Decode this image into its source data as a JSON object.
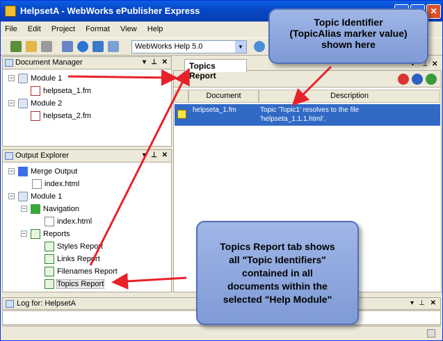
{
  "window": {
    "title": "HelpsetA - WebWorks ePublisher Express",
    "minimize_label": "_",
    "maximize_label": "□",
    "close_label": "✕"
  },
  "menu": [
    "File",
    "Edit",
    "Project",
    "Format",
    "View",
    "Help"
  ],
  "toolbar": {
    "format_select_value": "WebWorks Help 5.0",
    "icons": [
      "new-project-icon",
      "open-icon",
      "save-icon",
      "search-icon",
      "settings-icon",
      "target-icon",
      "wizard-icon"
    ]
  },
  "document_manager": {
    "title": "Document Manager",
    "items": [
      {
        "label": "Module 1",
        "kind": "module"
      },
      {
        "label": "helpseta_1.fm",
        "kind": "fm"
      },
      {
        "label": "Module 2",
        "kind": "module"
      },
      {
        "label": "helpseta_2.fm",
        "kind": "fm"
      }
    ]
  },
  "output_explorer": {
    "title": "Output Explorer",
    "items": [
      {
        "label": "Merge Output",
        "kind": "merge"
      },
      {
        "label": "index.html",
        "kind": "doc"
      },
      {
        "label": "Module 1",
        "kind": "module"
      },
      {
        "label": "Navigation",
        "kind": "nav"
      },
      {
        "label": "index.html",
        "kind": "doc"
      },
      {
        "label": "Reports",
        "kind": "report"
      },
      {
        "label": "Styles Report",
        "kind": "report"
      },
      {
        "label": "Links Report",
        "kind": "report"
      },
      {
        "label": "Filenames Report",
        "kind": "report"
      },
      {
        "label": "Topics Report",
        "kind": "report"
      }
    ]
  },
  "topics_report": {
    "tab_label": "Topics Report",
    "columns": [
      "Document",
      "Description"
    ],
    "rows": [
      {
        "document": "helpseta_1.fm",
        "description_line1": "Topic 'Topic1' resolves to the file",
        "description_line2": "'helpseta_1.1.1.html'."
      }
    ]
  },
  "log": {
    "title": "Log for: HelpsetA"
  },
  "callouts": {
    "top_line1": "Topic Identifier",
    "top_line2": "(TopicAlias marker value)",
    "top_line3": "shown here",
    "bottom_line1": "Topics Report tab shows",
    "bottom_line2": "all \"Topic Identifiers\"",
    "bottom_line3": "contained in all",
    "bottom_line4": "documents within the",
    "bottom_line5": "selected \"Help Module\""
  },
  "colors": {
    "accent": "#316ac5",
    "titlebar": "#0a5fe3",
    "callout_fill": "#8fa8dc",
    "arrow": "#e8202a"
  }
}
